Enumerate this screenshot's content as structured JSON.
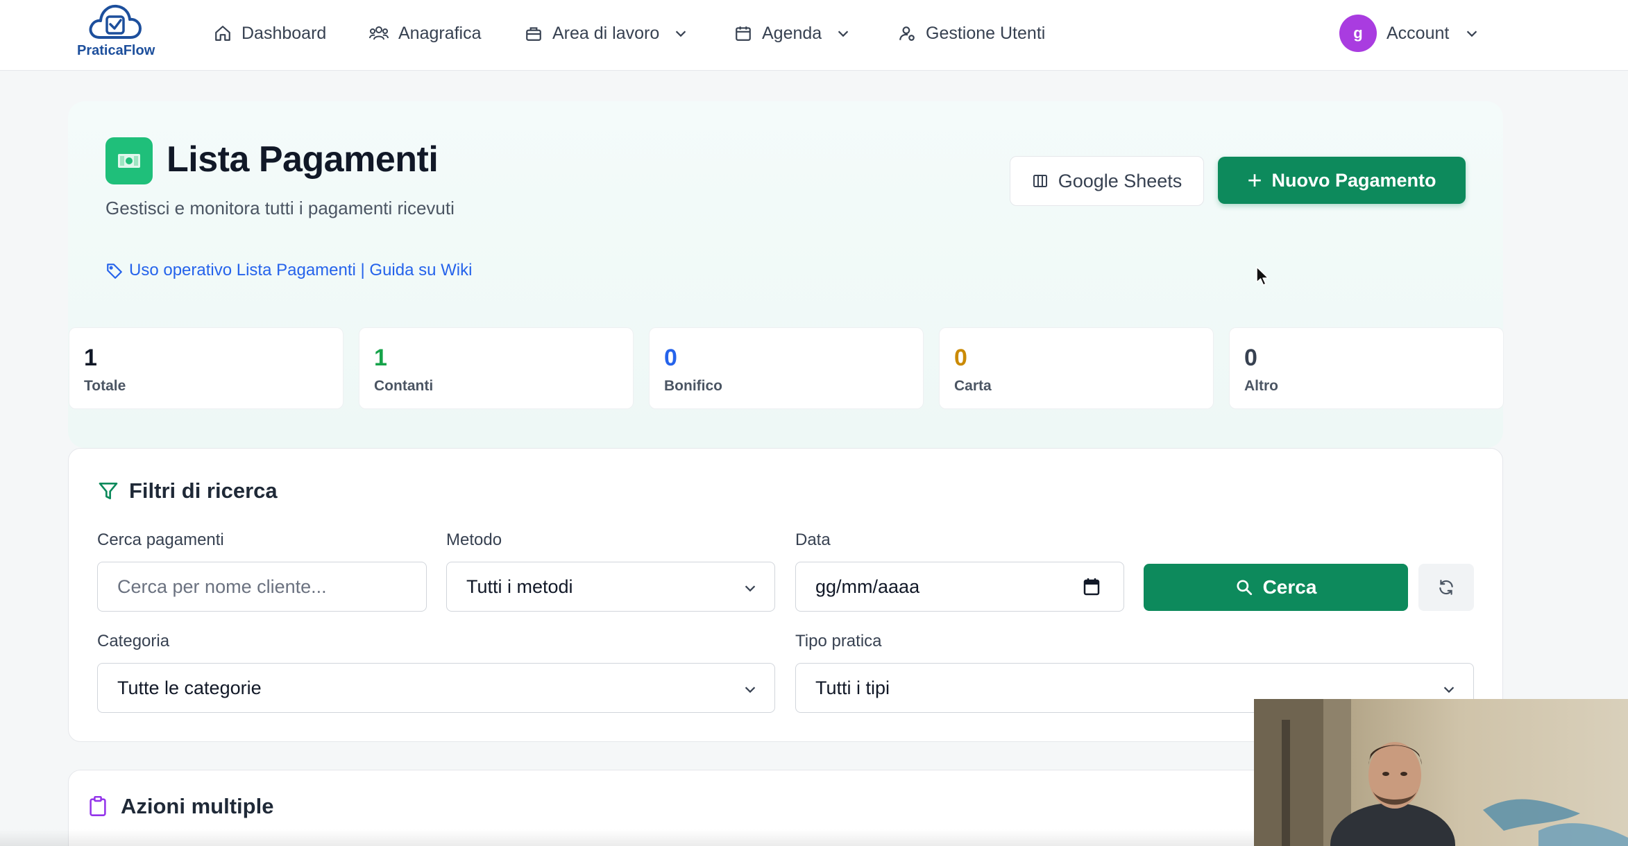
{
  "app": {
    "brand": "PraticaFlow"
  },
  "nav": {
    "dashboard": "Dashboard",
    "anagrafica": "Anagrafica",
    "area_lavoro": "Area di lavoro",
    "agenda": "Agenda",
    "gestione_utenti": "Gestione Utenti",
    "account_initial": "g",
    "account_label": "Account"
  },
  "page": {
    "title": "Lista Pagamenti",
    "subtitle": "Gestisci e monitora tutti i pagamenti ricevuti",
    "wiki_link": "Uso operativo Lista Pagamenti | Guida su Wiki",
    "google_sheets": "Google Sheets",
    "new_payment": "Nuovo Pagamento"
  },
  "stats": [
    {
      "value": "1",
      "label": "Totale",
      "color": "#111827"
    },
    {
      "value": "1",
      "label": "Contanti",
      "color": "#16a34a"
    },
    {
      "value": "0",
      "label": "Bonifico",
      "color": "#2563eb"
    },
    {
      "value": "0",
      "label": "Carta",
      "color": "#ca8a04"
    },
    {
      "value": "0",
      "label": "Altro",
      "color": "#374151"
    }
  ],
  "filters": {
    "title": "Filtri di ricerca",
    "search_label": "Cerca pagamenti",
    "search_placeholder": "Cerca per nome cliente...",
    "method_label": "Metodo",
    "method_value": "Tutti i metodi",
    "date_label": "Data",
    "date_placeholder": "gg/mm/aaaa",
    "search_button": "Cerca",
    "category_label": "Categoria",
    "category_value": "Tutte le categorie",
    "type_label": "Tipo pratica",
    "type_value": "Tutti i tipi"
  },
  "bulk": {
    "title": "Azioni multiple"
  },
  "colors": {
    "primary": "#0d8a5c",
    "link": "#2563eb",
    "avatar": "#a93ce0",
    "logo": "#1d4f9c"
  },
  "icons": [
    "home-icon",
    "users-icon",
    "briefcase-icon",
    "calendar-icon",
    "user-cog-icon",
    "chevron-down-icon",
    "money-icon",
    "columns-icon",
    "plus-icon",
    "tag-icon",
    "filter-icon",
    "search-icon",
    "refresh-icon",
    "calendar-picker-icon",
    "clipboard-icon",
    "cursor-icon"
  ]
}
